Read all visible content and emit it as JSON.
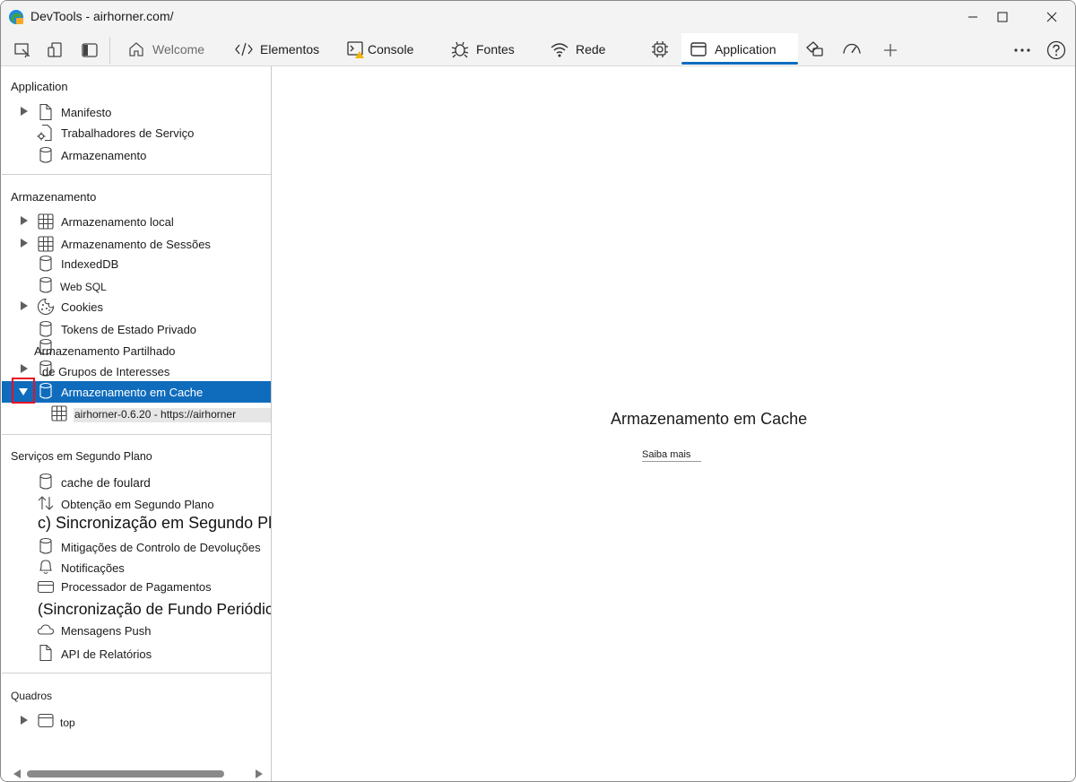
{
  "window": {
    "title": "DevTools - airhorner.com/"
  },
  "toolbar": {
    "tabs": [
      {
        "label": "Welcome",
        "icon": "home-icon"
      },
      {
        "label": "Elementos",
        "icon": "code-icon"
      },
      {
        "label": "Console",
        "icon": "console-warning-icon"
      },
      {
        "label": "Fontes",
        "icon": "bug-icon"
      },
      {
        "label": "Rede",
        "icon": "wifi-icon"
      },
      {
        "label": "",
        "icon": "cpu-icon"
      },
      {
        "label": "Application",
        "icon": "application-icon"
      },
      {
        "label": "",
        "icon": "paint-icon"
      },
      {
        "label": "",
        "icon": "gauge-icon"
      }
    ]
  },
  "sidebar": {
    "application": {
      "header": "Application",
      "items": [
        "Manifesto",
        "Trabalhadores de Serviço",
        "Armazenamento"
      ]
    },
    "storage": {
      "header": "Armazenamento",
      "items": [
        "Armazenamento local",
        "Armazenamento de Sessões",
        "IndexedDB",
        "Web SQL",
        "Cookies",
        "Tokens de Estado Privado"
      ],
      "shared_line1": "Armazenamento Partilhado",
      "shared_line2": "de Grupos de Interesses",
      "cache_storage": "Armazenamento em Cache",
      "cache_entry": "airhorner-0.6.20 - https://airhorner"
    },
    "background": {
      "header": "Serviços em Segundo Plano",
      "items": {
        "cache": "cache de foulard",
        "fetch": "Obtenção em Segundo Plano",
        "sync": "c) Sincronização em Segundo Plano",
        "bounce": "Mitigações de Controlo de Devoluções",
        "notifications": "Notificações",
        "payment": "Processador de Pagamentos",
        "periodic": "(Sincronização de Fundo Periódica D",
        "push": "Mensagens Push",
        "reporting": "API de Relatórios"
      }
    },
    "frames": {
      "header": "Quadros",
      "items": [
        "top"
      ]
    }
  },
  "main": {
    "title": "Armazenamento em Cache",
    "link": "Saiba mais"
  }
}
